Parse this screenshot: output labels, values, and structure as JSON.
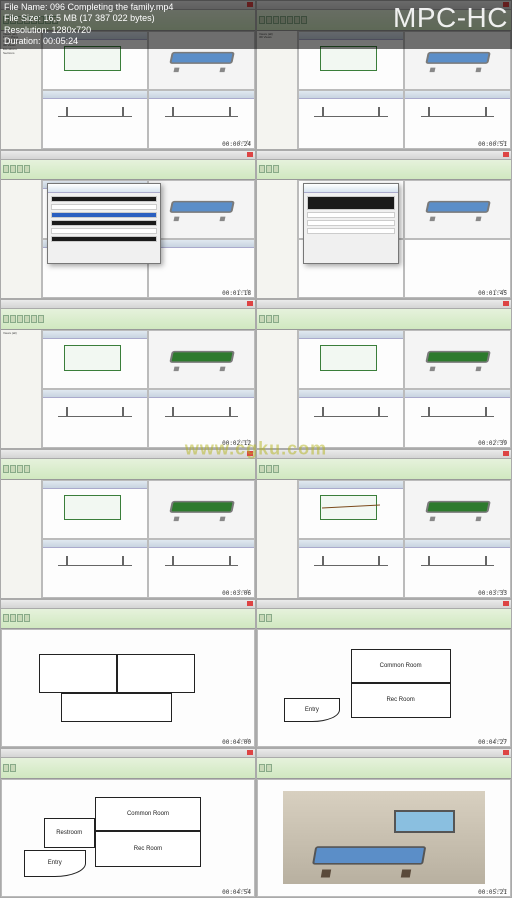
{
  "header": {
    "file_name_label": "File Name:",
    "file_name": "096 Completing the family.mp4",
    "file_size_label": "File Size:",
    "file_size": "16,5 MB (17 387 022 bytes)",
    "resolution_label": "Resolution:",
    "resolution": "1280x720",
    "duration_label": "Duration:",
    "duration": "00:05:24",
    "app": "MPC-HC"
  },
  "watermark_site": "www.cgku.com",
  "brand": "lynda",
  "timecodes": [
    "00:00:24",
    "00:00:51",
    "00:01:18",
    "00:01:45",
    "00:02:12",
    "00:02:39",
    "00:03:06",
    "00:03:33",
    "00:04:00",
    "00:04:27",
    "00:04:54",
    "00:05:21"
  ],
  "rooms": {
    "common": "Common Room",
    "rec": "Rec Room",
    "rest": "Restroom",
    "entry": "Entry"
  },
  "sidebar_items": [
    "Views (all)",
    "Floor Plans",
    "Ceiling Plans",
    "3D Views",
    "Elevations",
    "Sections",
    "Families",
    "Groups"
  ]
}
